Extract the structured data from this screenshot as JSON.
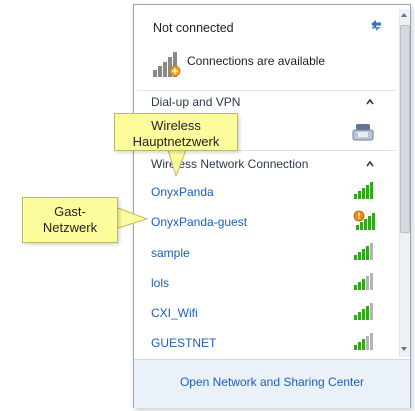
{
  "panel": {
    "status_title": "Not connected",
    "availability_text": "Connections are available",
    "refresh_icon": "refresh-arrows-icon"
  },
  "sections": {
    "dialup": {
      "label": "Dial-up and VPN",
      "icon": "telephone-modem-icon"
    },
    "wireless": {
      "label": "Wireless Network Connection"
    }
  },
  "networks": [
    {
      "name": "OnyxPanda",
      "signal": 5,
      "secured_warning": false
    },
    {
      "name": "OnyxPanda-guest",
      "signal": 5,
      "secured_warning": true
    },
    {
      "name": "sample",
      "signal": 4,
      "secured_warning": false
    },
    {
      "name": "lols",
      "signal": 3,
      "secured_warning": false
    },
    {
      "name": "CXI_Wifi",
      "signal": 4,
      "secured_warning": false
    },
    {
      "name": "GUESTNET",
      "signal": 3,
      "secured_warning": false
    }
  ],
  "footer": {
    "link": "Open Network and Sharing Center"
  },
  "callouts": {
    "wireless_main": "Wireless Hauptnetzwerk",
    "guest_network": "Gast-Netzwerk"
  },
  "colors": {
    "link": "#1c5fb5",
    "signal_green": "#35a41f",
    "signal_gray": "#b4b4b4",
    "callout_yellow": "#fdfc9d"
  }
}
